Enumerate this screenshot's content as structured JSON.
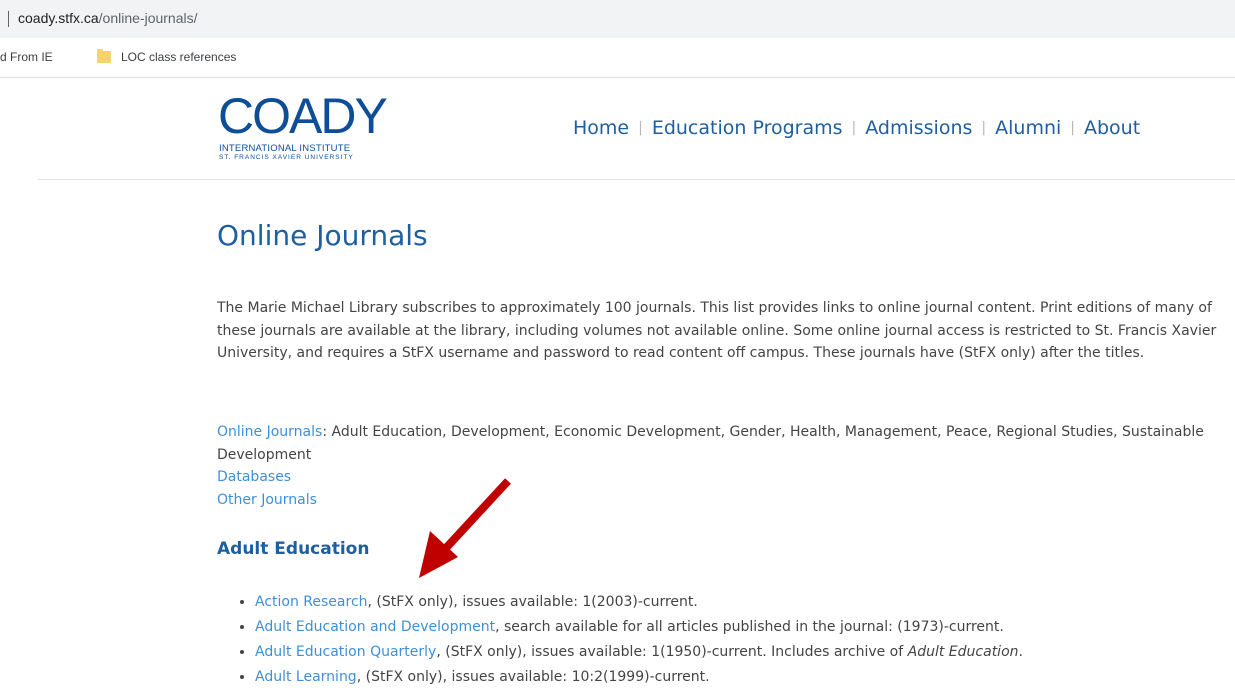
{
  "browser": {
    "url_host": "coady.stfx.ca",
    "url_path": "/online-journals/",
    "bookmarks": [
      {
        "label": "d From IE"
      },
      {
        "label": "LOC class references"
      }
    ]
  },
  "site": {
    "logo": {
      "word": "COADY",
      "line1": "INTERNATIONAL INSTITUTE",
      "line2": "ST. FRANCIS XAVIER UNIVERSITY"
    },
    "nav": [
      "Home",
      "Education Programs",
      "Admissions",
      "Alumni",
      "About"
    ],
    "nav_separator": "|"
  },
  "page": {
    "title": "Online Journals",
    "intro": "The Marie Michael Library subscribes to approximately 100 journals. This list provides links to online journal content. Print editions of many of these journals are available at the library, including volumes not available online. Some online journal access is restricted to St. Francis Xavier University, and requires a StFX username and password to read content off campus. These journals have (StFX only) after the titles.",
    "online_journals_link": "Online Journals",
    "online_journals_topics": ": Adult Education, Development, Economic Development, Gender, Health, Management, Peace, Regional Studies, Sustainable Development",
    "databases_link": "Databases",
    "other_journals_link": "Other Journals",
    "section_title": "Adult Education",
    "journals": [
      {
        "title": "Action Research",
        "details": ", (StFX only), issues available: 1(2003)-current.",
        "archive_prefix": "",
        "archive_title": "",
        "archive_suffix": ""
      },
      {
        "title": "Adult Education and Development",
        "details": ", search available for all articles published in the journal: (1973)-current.",
        "archive_prefix": "",
        "archive_title": "",
        "archive_suffix": ""
      },
      {
        "title": "Adult Education Quarterly",
        "details": ", (StFX only), issues available: 1(1950)-current. ",
        "archive_prefix": "Includes archive of ",
        "archive_title": "Adult Education",
        "archive_suffix": "."
      },
      {
        "title": "Adult Learning",
        "details": ", (StFX only), issues available: 10:2(1999)-current.",
        "archive_prefix": "",
        "archive_title": "",
        "archive_suffix": ""
      }
    ]
  },
  "colors": {
    "brand_blue": "#0d4e96",
    "nav_blue": "#1f5fa0",
    "link_blue": "#3f8fd6",
    "annotation_arrow": "#c00000"
  }
}
